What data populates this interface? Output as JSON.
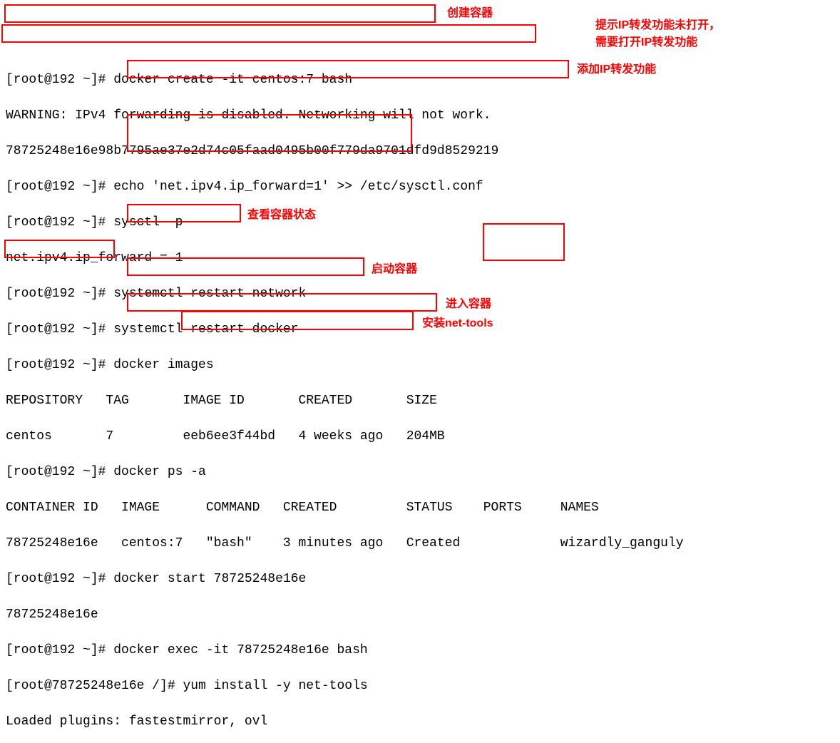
{
  "lines": {
    "l0_prompt": "[root@192 ~]# ",
    "l0_cmd": "docker create -it centos:7 bash",
    "l1": "WARNING: IPv4 forwarding is disabled. Networking will not work.",
    "l2": "78725248e16e98b7795ae37e2d74c05faad0495b00f779da9701dfd9d8529219",
    "l3_prompt": "[root@192 ~]# ",
    "l3_cmd": "echo 'net.ipv4.ip_forward=1' >> /etc/sysctl.conf",
    "l4": "[root@192 ~]# sysctl -p",
    "l5": "net.ipv4.ip_forward = 1",
    "l6_prompt": "[root@192 ~]# ",
    "l6_cmd": "systemctl restart network",
    "l7_prompt": "[root@192 ~]# ",
    "l7_cmd": "systemctl restart docker",
    "l8": "[root@192 ~]# docker images",
    "l9": "REPOSITORY   TAG       IMAGE ID       CREATED       SIZE",
    "l10": "centos       7         eeb6ee3f44bd   4 weeks ago   204MB",
    "l11_prompt": "[root@192 ~]# ",
    "l11_cmd": "docker ps -a",
    "l12_header": "CONTAINER ID   IMAGE      COMMAND   CREATED         STATUS    PORTS     NAMES",
    "l13_row": "78725248e16e   centos:7   \"bash\"    3 minutes ago   Created             wizardly_ganguly",
    "l14_prompt": "[root@192 ~]# ",
    "l14_cmd": "docker start 78725248e16e",
    "l15": "78725248e16e",
    "l16_prompt": "[root@192 ~]# ",
    "l16_cmd": "docker exec -it 78725248e16e bash",
    "l17_prompt": "[root@78725248e16e /]# ",
    "l17_cmd": "yum install -y net-tools",
    "l18": "Loaded plugins: fastestmirror, ovl"
  },
  "annotations": {
    "a1": "创建容器",
    "a2_l1": "提示IP转发功能未打开，",
    "a2_l2": "需要打开IP转发功能",
    "a3": "添加IP转发功能",
    "a4": "查看容器状态",
    "a5": "启动容器",
    "a6": "进入容器",
    "a7": "安装net-tools"
  }
}
